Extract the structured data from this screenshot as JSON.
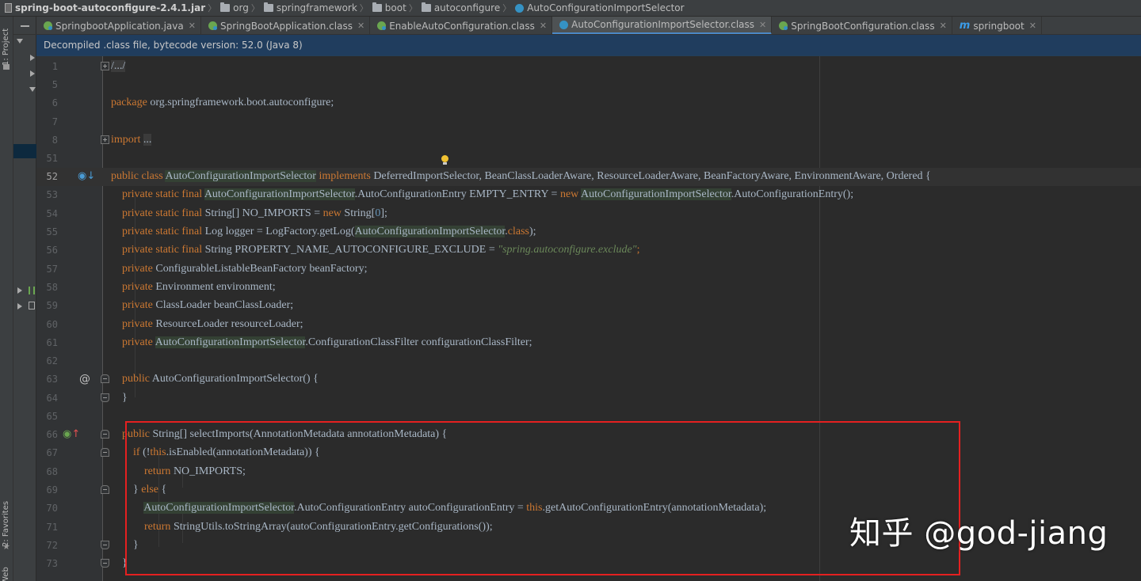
{
  "breadcrumb": [
    "spring-boot-autoconfigure-2.4.1.jar",
    "org",
    "springframework",
    "boot",
    "autoconfigure",
    "AutoConfigurationImportSelector"
  ],
  "left_strip": {
    "project_label": "1: Project",
    "favorites_label": "2: Favorites",
    "web_label": "Web"
  },
  "tabs": [
    {
      "label": "SpringbootApplication.java",
      "icon": "spring-class-icon",
      "active": false
    },
    {
      "label": "SpringBootApplication.class",
      "icon": "spring-class-icon",
      "active": false
    },
    {
      "label": "EnableAutoConfiguration.class",
      "icon": "spring-class-icon",
      "active": false
    },
    {
      "label": "AutoConfigurationImportSelector.class",
      "icon": "class-icon",
      "active": true
    },
    {
      "label": "SpringBootConfiguration.class",
      "icon": "spring-class-icon",
      "active": false
    },
    {
      "label": "springboot",
      "icon": "maven-module-icon",
      "active": false
    }
  ],
  "banner": {
    "text": "Decompiled .class file, bytecode version: 52.0 (Java 8)"
  },
  "editor": {
    "line_numbers": [
      "1",
      "5",
      "6",
      "7",
      "8",
      "51",
      "52",
      "53",
      "54",
      "55",
      "56",
      "57",
      "58",
      "59",
      "60",
      "61",
      "62",
      "63",
      "64",
      "65",
      "66",
      "67",
      "68",
      "69",
      "70",
      "71",
      "72",
      "73"
    ],
    "code": {
      "l1_fold": "/.../",
      "l6_pkg": "package",
      "l6_rest": " org.springframework.boot.autoconfigure;",
      "l8_import": "import",
      "l8_fold": "...",
      "kw_public": "public",
      "kw_class": "class",
      "kw_implements": "implements",
      "kw_private": "private",
      "kw_static": "static",
      "kw_final": "final",
      "kw_new": "new",
      "kw_if": "if",
      "kw_this": "this",
      "kw_return": "return",
      "kw_else": "else",
      "kw_class_lit": "class",
      "class_name": "AutoConfigurationImportSelector",
      "l52_tail": " DeferredImportSelector, BeanClassLoaderAware, ResourceLoaderAware, BeanFactoryAware, EnvironmentAware, Ordered {",
      "l53_mid": ".AutoConfigurationEntry EMPTY_ENTRY = ",
      "l53_tail": ".AutoConfigurationEntry();",
      "l54_mid": " String[] NO_IMPORTS = ",
      "l54_tail": " String[",
      "l54_num": "0",
      "l54_end": "];",
      "l55_mid": " Log logger = LogFactory.getLog(",
      "l55_dot": ".",
      "l55_end": ");",
      "l56_mid": " String PROPERTY_NAME_AUTOCONFIGURE_EXCLUDE = ",
      "l56_str": "\"spring.autoconfigure.exclude\"",
      "l56_end": ";",
      "l57_rest": " ConfigurableListableBeanFactory beanFactory;",
      "l58_rest": " Environment environment;",
      "l59_rest": " ClassLoader beanClassLoader;",
      "l60_rest": " ResourceLoader resourceLoader;",
      "l61_tail": ".ConfigurationClassFilter configurationClassFilter;",
      "l63_rest": " AutoConfigurationImportSelector() {",
      "l64": "}",
      "l66_rest": " String[] selectImports(AnnotationMetadata annotationMetadata) {",
      "l67_open": " (!",
      "l67_rest": ".isEnabled(annotationMetadata)) {",
      "l68_rest": " NO_IMPORTS;",
      "l69_pre": "} ",
      "l69_post": " {",
      "l70_mid": ".AutoConfigurationEntry autoConfigurationEntry = ",
      "l70_tail": ".getAutoConfigurationEntry(annotationMetadata);",
      "l71_rest": " StringUtils.toStringArray(autoConfigurationEntry.getConfigurations());",
      "l72": "}",
      "l73": "}"
    }
  },
  "watermark": "知乎 @god-jiang",
  "colors": {
    "keyword": "#cc7832",
    "string": "#6a8759",
    "number": "#6897bb",
    "identifier": "#a9b7c6",
    "highlight_box": "#e52020",
    "banner_bg": "#203d5e"
  }
}
